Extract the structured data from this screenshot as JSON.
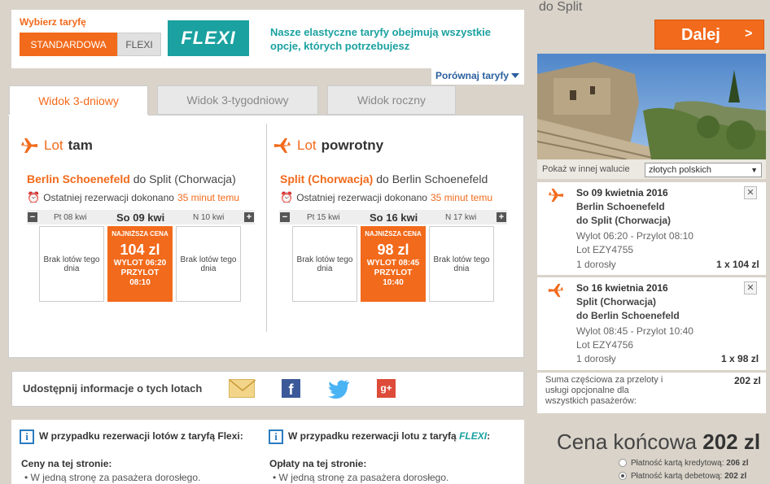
{
  "tariff": {
    "heading": "Wybierz taryfę",
    "standard_label": "STANDARDOWA",
    "flexi_label": "FLEXI",
    "flexi_logo": "FLEXI",
    "flexi_desc": "Nasze elastyczne taryfy obejmują wszystkie opcje, których potrzebujesz",
    "compare_link": "Porównaj taryfy"
  },
  "tabs": [
    "Widok 3-dniowy",
    "Widok 3-tygodniowy",
    "Widok roczny"
  ],
  "outbound": {
    "title_prefix": "Lot",
    "title": "tam",
    "from": "Berlin Schoenefeld",
    "to_text": "do Split (Chorwacja)",
    "last_res_text": "Ostatniej rezerwacji dokonano",
    "last_res_time": "35 minut temu",
    "prev_day": "Pt 08 kwi",
    "sel_day": "So 09 kwi",
    "next_day": "N 10 kwi",
    "no_flights_left": "Brak lotów tego dnia",
    "no_flights_right": "Brak lotów tego dnia",
    "lowest_label": "NAJNIŻSZA CENA",
    "price": "104 zl",
    "departure": "WYLOT 06:20",
    "arrival_label": "PRZYLOT",
    "arrival": "08:10"
  },
  "return": {
    "title_prefix": "Lot",
    "title": "powrotny",
    "from": "Split (Chorwacja)",
    "to_text": "do Berlin Schoenefeld",
    "last_res_text": "Ostatniej rezerwacji dokonano",
    "last_res_time": "35 minut temu",
    "prev_day": "Pt 15 kwi",
    "sel_day": "So 16 kwi",
    "next_day": "N 17 kwi",
    "no_flights_left": "Brak lotów tego dnia",
    "no_flights_right": "Brak lotów tego dnia",
    "lowest_label": "NAJNIŻSZA CENA",
    "price": "98 zl",
    "departure": "WYLOT 08:45",
    "arrival_label": "PRZYLOT",
    "arrival": "10:40"
  },
  "share": {
    "label": "Udostępnij informacje o tych lotach"
  },
  "info_left": {
    "heading": "W przypadku rezerwacji lotów z taryfą Flexi:",
    "subheading": "Ceny na tej stronie:",
    "bullet": "W jedną stronę za pasażera dorosłego."
  },
  "info_right": {
    "heading_prefix": "W przypadku rezerwacji lotu z taryfą",
    "heading_brand": "FLEXI",
    "heading_suffix": ":",
    "subheading": "Opłaty na tej stronie:",
    "bullet": "W jedną stronę za pasażera dorosłego."
  },
  "summary": {
    "dest_title": "do Split",
    "next_button": "Dalej",
    "currency_label": "Pokaż w innej walucie",
    "currency_value": "złotych polskich",
    "flights": [
      {
        "date": "So 09 kwietnia 2016",
        "from": "Berlin Schoenefeld",
        "to": "do Split (Chorwacja)",
        "times": "Wylot 06:20 - Przylot 08:10",
        "flight_no": "Lot EZY4755",
        "pax": "1 dorosły",
        "price": "1 x 104 zl"
      },
      {
        "date": "So 16 kwietnia 2016",
        "from": "Split (Chorwacja)",
        "to": "do Berlin Schoenefeld",
        "times": "Wylot 08:45 - Przylot 10:40",
        "flight_no": "Lot EZY4756",
        "pax": "1 dorosły",
        "price": "1 x 98 zl"
      }
    ],
    "subtotal_label": "Suma częściowa za przeloty i usługi opcjonalne dla wszystkich pasażerów:",
    "subtotal": "202 zl",
    "final_label": "Cena końcowa",
    "final_price": "202 zl",
    "pay_credit_label": "Płatność kartą kredytową:",
    "pay_credit": "206 zl",
    "pay_debit_label": "Płatność kartą debetową:",
    "pay_debit": "202 zl"
  },
  "colors": {
    "accent": "#f26a1b",
    "teal": "#1aa1a0",
    "link": "#2a5f9e"
  }
}
